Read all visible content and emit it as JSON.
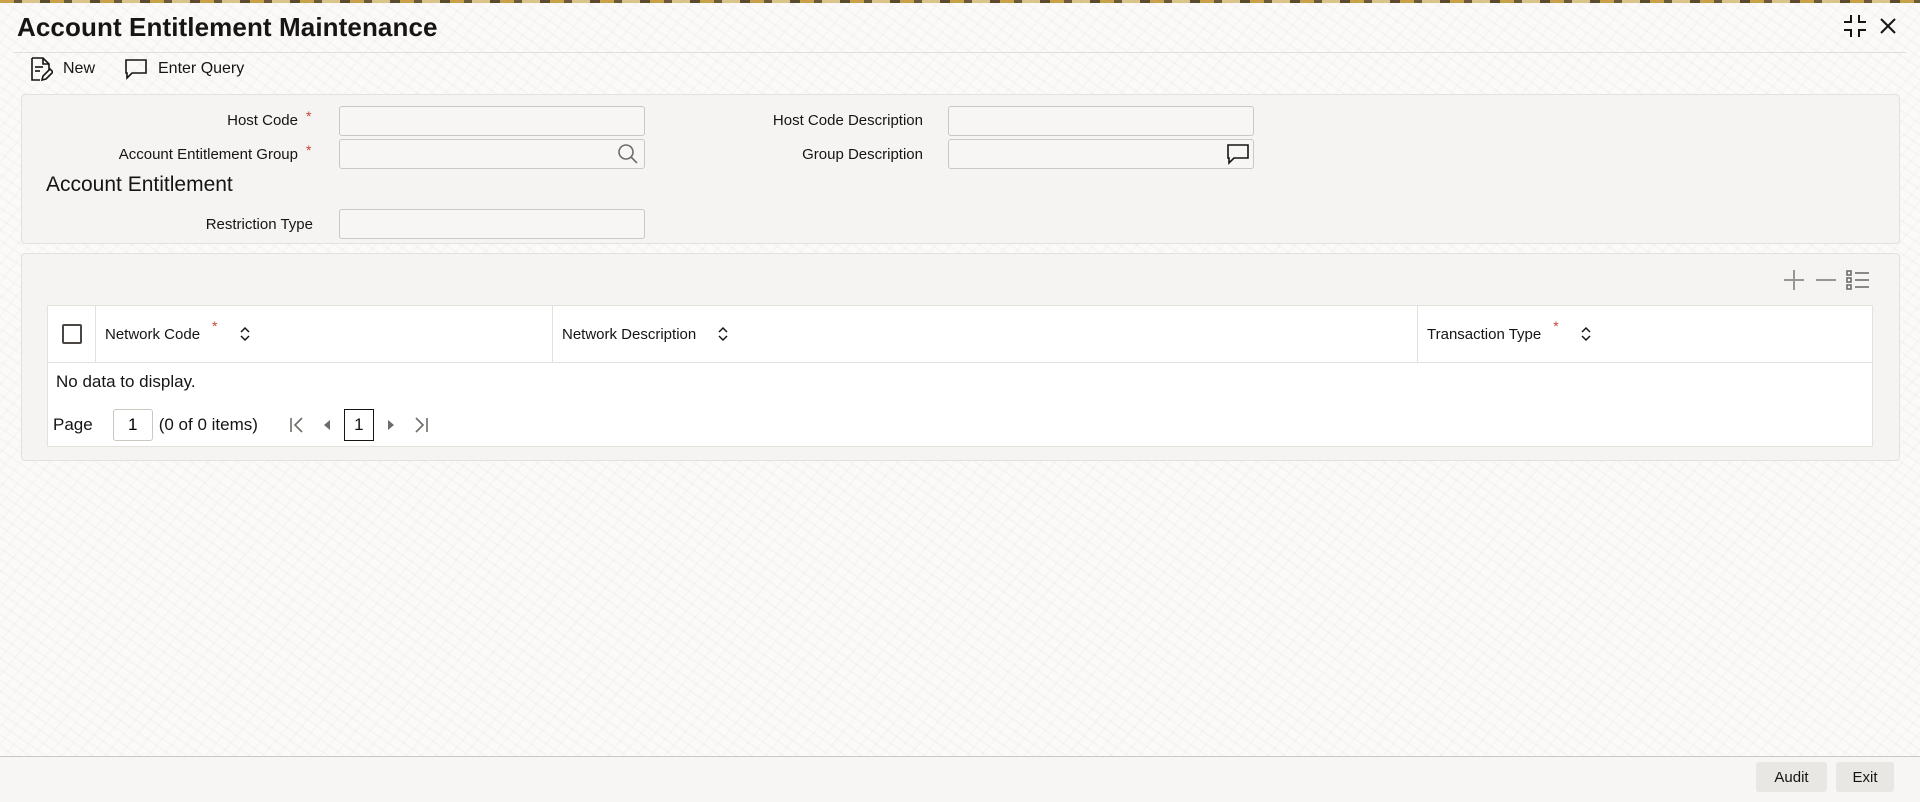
{
  "window": {
    "title": "Account Entitlement Maintenance",
    "minimize_icon": "collapse-icon",
    "close_icon": "close-icon"
  },
  "toolbar": {
    "new_label": "New",
    "enter_query_label": "Enter Query"
  },
  "form": {
    "host_code_label": "Host Code",
    "host_code_value": "",
    "host_code_description_label": "Host Code Description",
    "host_code_description_value": "",
    "account_entitlement_group_label": "Account Entitlement Group",
    "account_entitlement_group_value": "",
    "group_description_label": "Group Description",
    "group_description_value": "",
    "required_marker": "*"
  },
  "account_entitlement": {
    "section_title": "Account Entitlement",
    "restriction_type_label": "Restriction Type",
    "restriction_type_value": ""
  },
  "grid": {
    "columns": [
      "Network Code",
      "Network Description",
      "Transaction Type"
    ],
    "rows": [],
    "empty_message": "No data to display.",
    "page_label": "Page",
    "page_value": "1",
    "item_count": "(0 of 0 items)",
    "current_page": "1"
  },
  "footer": {
    "audit_label": "Audit",
    "exit_label": "Exit"
  },
  "colors": {
    "required": "#c74634",
    "panel": "#f5f4f2",
    "text": "#161513"
  }
}
